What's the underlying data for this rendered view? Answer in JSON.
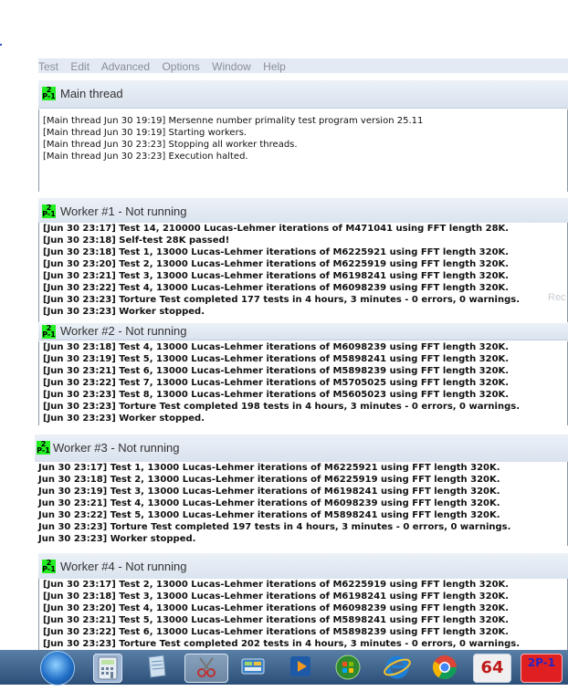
{
  "menu": [
    "Test",
    "Edit",
    "Advanced",
    "Options",
    "Window",
    "Help"
  ],
  "icon_text": "2P-1",
  "windows": [
    {
      "title": "Main thread",
      "lines": [
        "[Main thread Jun 30 19:19] Mersenne number primality test program version 25.11",
        "[Main thread Jun 30 19:19] Starting workers.",
        "[Main thread Jun 30 23:23] Stopping all worker threads.",
        "[Main thread Jun 30 23:23] Execution halted."
      ]
    },
    {
      "title": "Worker #1 - Not running",
      "lines": [
        "[Jun 30 23:17] Test 14, 210000 Lucas-Lehmer iterations of M471041 using FFT length 28K.",
        "[Jun 30 23:18] Self-test 28K passed!",
        "[Jun 30 23:18] Test 1, 13000 Lucas-Lehmer iterations of M6225921 using FFT length 320K.",
        "[Jun 30 23:20] Test 2, 13000 Lucas-Lehmer iterations of M6225919 using FFT length 320K.",
        "[Jun 30 23:21] Test 3, 13000 Lucas-Lehmer iterations of M6198241 using FFT length 320K.",
        "[Jun 30 23:22] Test 4, 13000 Lucas-Lehmer iterations of M6098239 using FFT length 320K.",
        "[Jun 30 23:23] Torture Test completed 177 tests in 4 hours, 3 minutes - 0 errors, 0 warnings.",
        "[Jun 30 23:23] Worker stopped."
      ]
    },
    {
      "title": "Worker #2 - Not running",
      "lines": [
        "[Jun 30 23:18] Test 4, 13000 Lucas-Lehmer iterations of M6098239 using FFT length 320K.",
        "[Jun 30 23:19] Test 5, 13000 Lucas-Lehmer iterations of M5898241 using FFT length 320K.",
        "[Jun 30 23:21] Test 6, 13000 Lucas-Lehmer iterations of M5898239 using FFT length 320K.",
        "[Jun 30 23:22] Test 7, 13000 Lucas-Lehmer iterations of M5705025 using FFT length 320K.",
        "[Jun 30 23:23] Test 8, 13000 Lucas-Lehmer iterations of M5605023 using FFT length 320K.",
        "[Jun 30 23:23] Torture Test completed 198 tests in 4 hours, 3 minutes - 0 errors, 0 warnings.",
        "[Jun 30 23:23] Worker stopped."
      ]
    },
    {
      "title": "Worker #3 - Not running",
      "lines": [
        "Jun 30 23:17] Test 1, 13000 Lucas-Lehmer iterations of M6225921 using FFT length 320K.",
        "Jun 30 23:18] Test 2, 13000 Lucas-Lehmer iterations of M6225919 using FFT length 320K.",
        "Jun 30 23:19] Test 3, 13000 Lucas-Lehmer iterations of M6198241 using FFT length 320K.",
        "Jun 30 23:21] Test 4, 13000 Lucas-Lehmer iterations of M6098239 using FFT length 320K.",
        "Jun 30 23:22] Test 5, 13000 Lucas-Lehmer iterations of M5898241 using FFT length 320K.",
        "Jun 30 23:23] Torture Test completed 197 tests in 4 hours, 3 minutes - 0 errors, 0 warnings.",
        "Jun 30 23:23] Worker stopped."
      ]
    },
    {
      "title": "Worker #4 - Not running",
      "lines": [
        "[Jun 30 23:17] Test 2, 13000 Lucas-Lehmer iterations of M6225919 using FFT length 320K.",
        "[Jun 30 23:18] Test 3, 13000 Lucas-Lehmer iterations of M6198241 using FFT length 320K.",
        "[Jun 30 23:20] Test 4, 13000 Lucas-Lehmer iterations of M6098239 using FFT length 320K.",
        "[Jun 30 23:21] Test 5, 13000 Lucas-Lehmer iterations of M5898241 using FFT length 320K.",
        "[Jun 30 23:22] Test 6, 13000 Lucas-Lehmer iterations of M5898239 using FFT length 320K.",
        "[Jun 30 23:23] Torture Test completed 202 tests in 4 hours, 3 minutes - 0 errors, 0 warnings."
      ]
    }
  ],
  "side_text": "Rec",
  "taskbar": {
    "cpu_label": "64",
    "prime_label": "2P-1",
    "items": [
      "start",
      "calculator",
      "notepad",
      "snipping-tool",
      "control-panel",
      "media-player",
      "windows-media-center",
      "internet-explorer",
      "chrome",
      "cpu-z",
      "prime95"
    ]
  }
}
